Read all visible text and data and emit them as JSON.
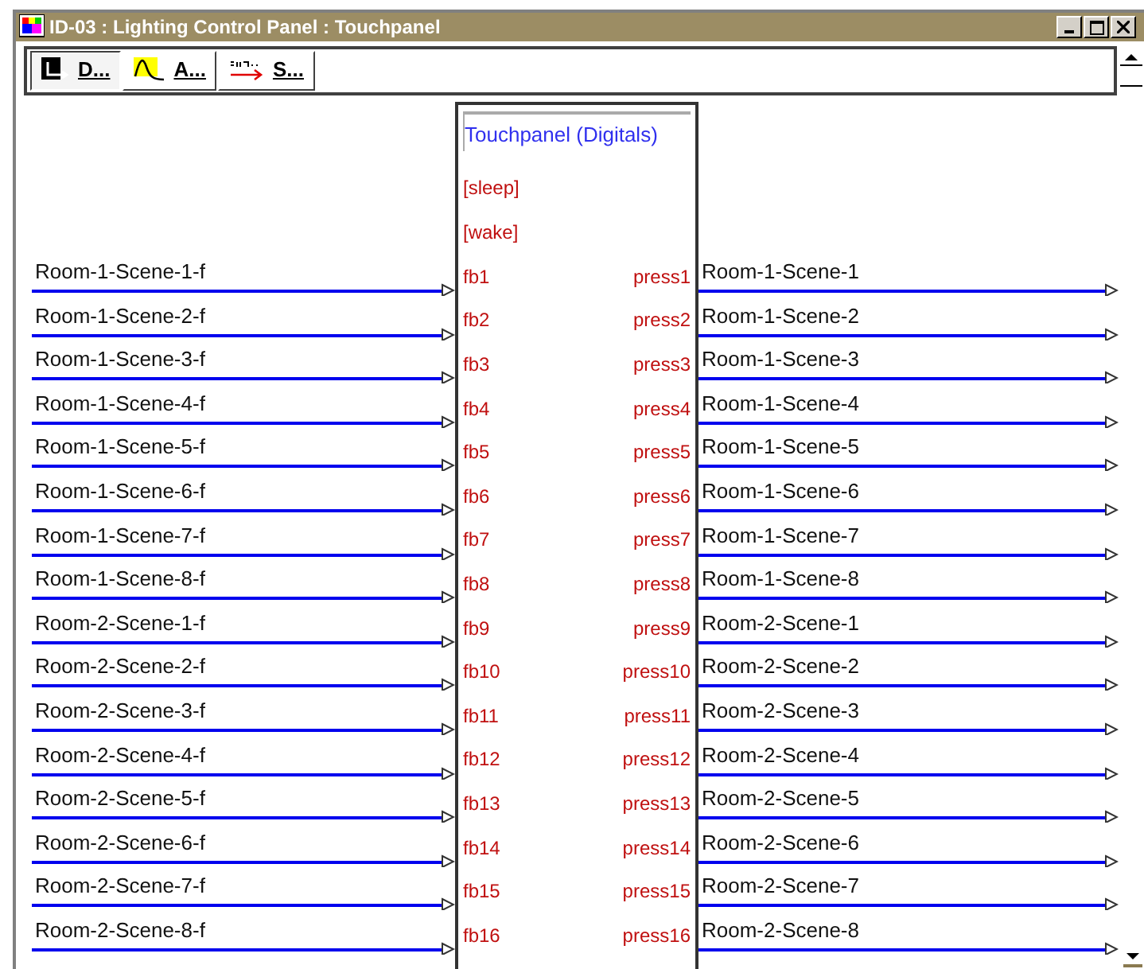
{
  "window": {
    "title": "ID-03 : Lighting Control Panel : Touchpanel"
  },
  "toolbar": {
    "buttons": [
      {
        "label": "D...",
        "selected": true,
        "kind": "digital"
      },
      {
        "label": "A...",
        "selected": false,
        "kind": "analog"
      },
      {
        "label": "S...",
        "selected": false,
        "kind": "serial"
      }
    ]
  },
  "block": {
    "title": "Touchpanel (Digitals)",
    "fixed_inputs": [
      "[sleep]",
      "[wake]"
    ],
    "rows": [
      {
        "input_signal": "Room-1-Scene-1-f",
        "input": "fb1",
        "output": "press1",
        "output_signal": "Room-1-Scene-1"
      },
      {
        "input_signal": "Room-1-Scene-2-f",
        "input": "fb2",
        "output": "press2",
        "output_signal": "Room-1-Scene-2"
      },
      {
        "input_signal": "Room-1-Scene-3-f",
        "input": "fb3",
        "output": "press3",
        "output_signal": "Room-1-Scene-3"
      },
      {
        "input_signal": "Room-1-Scene-4-f",
        "input": "fb4",
        "output": "press4",
        "output_signal": "Room-1-Scene-4"
      },
      {
        "input_signal": "Room-1-Scene-5-f",
        "input": "fb5",
        "output": "press5",
        "output_signal": "Room-1-Scene-5"
      },
      {
        "input_signal": "Room-1-Scene-6-f",
        "input": "fb6",
        "output": "press6",
        "output_signal": "Room-1-Scene-6"
      },
      {
        "input_signal": "Room-1-Scene-7-f",
        "input": "fb7",
        "output": "press7",
        "output_signal": "Room-1-Scene-7"
      },
      {
        "input_signal": "Room-1-Scene-8-f",
        "input": "fb8",
        "output": "press8",
        "output_signal": "Room-1-Scene-8"
      },
      {
        "input_signal": "Room-2-Scene-1-f",
        "input": "fb9",
        "output": "press9",
        "output_signal": "Room-2-Scene-1"
      },
      {
        "input_signal": "Room-2-Scene-2-f",
        "input": "fb10",
        "output": "press10",
        "output_signal": "Room-2-Scene-2"
      },
      {
        "input_signal": "Room-2-Scene-3-f",
        "input": "fb11",
        "output": "press11",
        "output_signal": "Room-2-Scene-3"
      },
      {
        "input_signal": "Room-2-Scene-4-f",
        "input": "fb12",
        "output": "press12",
        "output_signal": "Room-2-Scene-4"
      },
      {
        "input_signal": "Room-2-Scene-5-f",
        "input": "fb13",
        "output": "press13",
        "output_signal": "Room-2-Scene-5"
      },
      {
        "input_signal": "Room-2-Scene-6-f",
        "input": "fb14",
        "output": "press14",
        "output_signal": "Room-2-Scene-6"
      },
      {
        "input_signal": "Room-2-Scene-7-f",
        "input": "fb15",
        "output": "press15",
        "output_signal": "Room-2-Scene-7"
      },
      {
        "input_signal": "Room-2-Scene-8-f",
        "input": "fb16",
        "output": "press16",
        "output_signal": "Room-2-Scene-8"
      }
    ]
  }
}
